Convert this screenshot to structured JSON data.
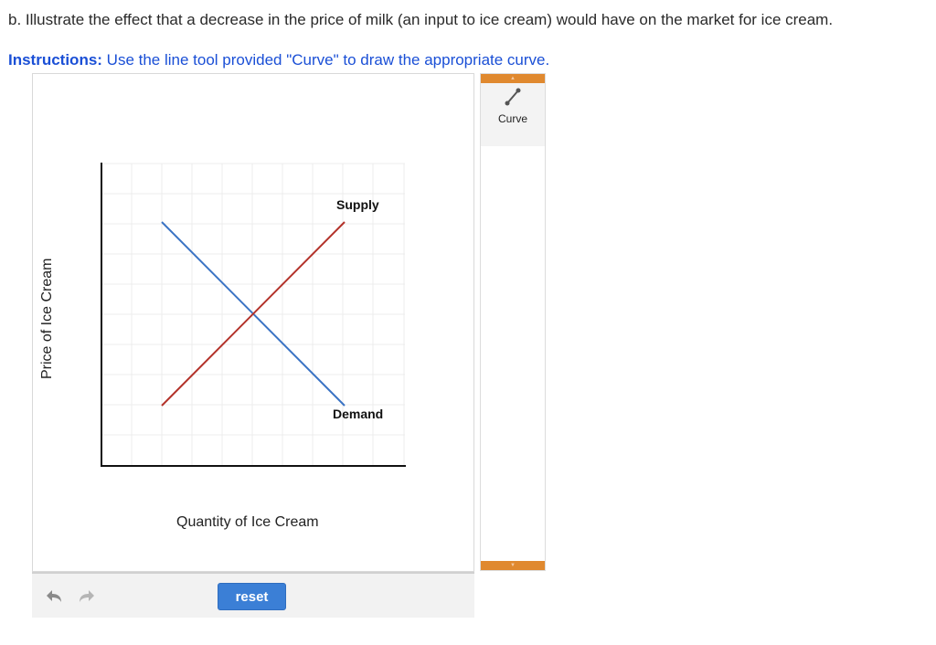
{
  "question": {
    "text": "b. Illustrate the effect that a decrease in the price of milk (an input to ice cream) would have on the market for ice cream."
  },
  "instructions": {
    "lead": "Instructions:",
    "text": " Use the line tool provided \"Curve\" to draw the appropriate curve."
  },
  "graph": {
    "y_axis_label": "Price of Ice Cream",
    "x_axis_label": "Quantity of Ice Cream",
    "supply_label": "Supply",
    "demand_label": "Demand",
    "supply_color": "#b3322a",
    "demand_color": "#3a73c4"
  },
  "tools": {
    "curve_label": "Curve",
    "accent_color": "#e0892f"
  },
  "toolbar": {
    "undo_icon": "undo-icon",
    "redo_icon": "redo-icon",
    "reset_label": "reset"
  }
}
